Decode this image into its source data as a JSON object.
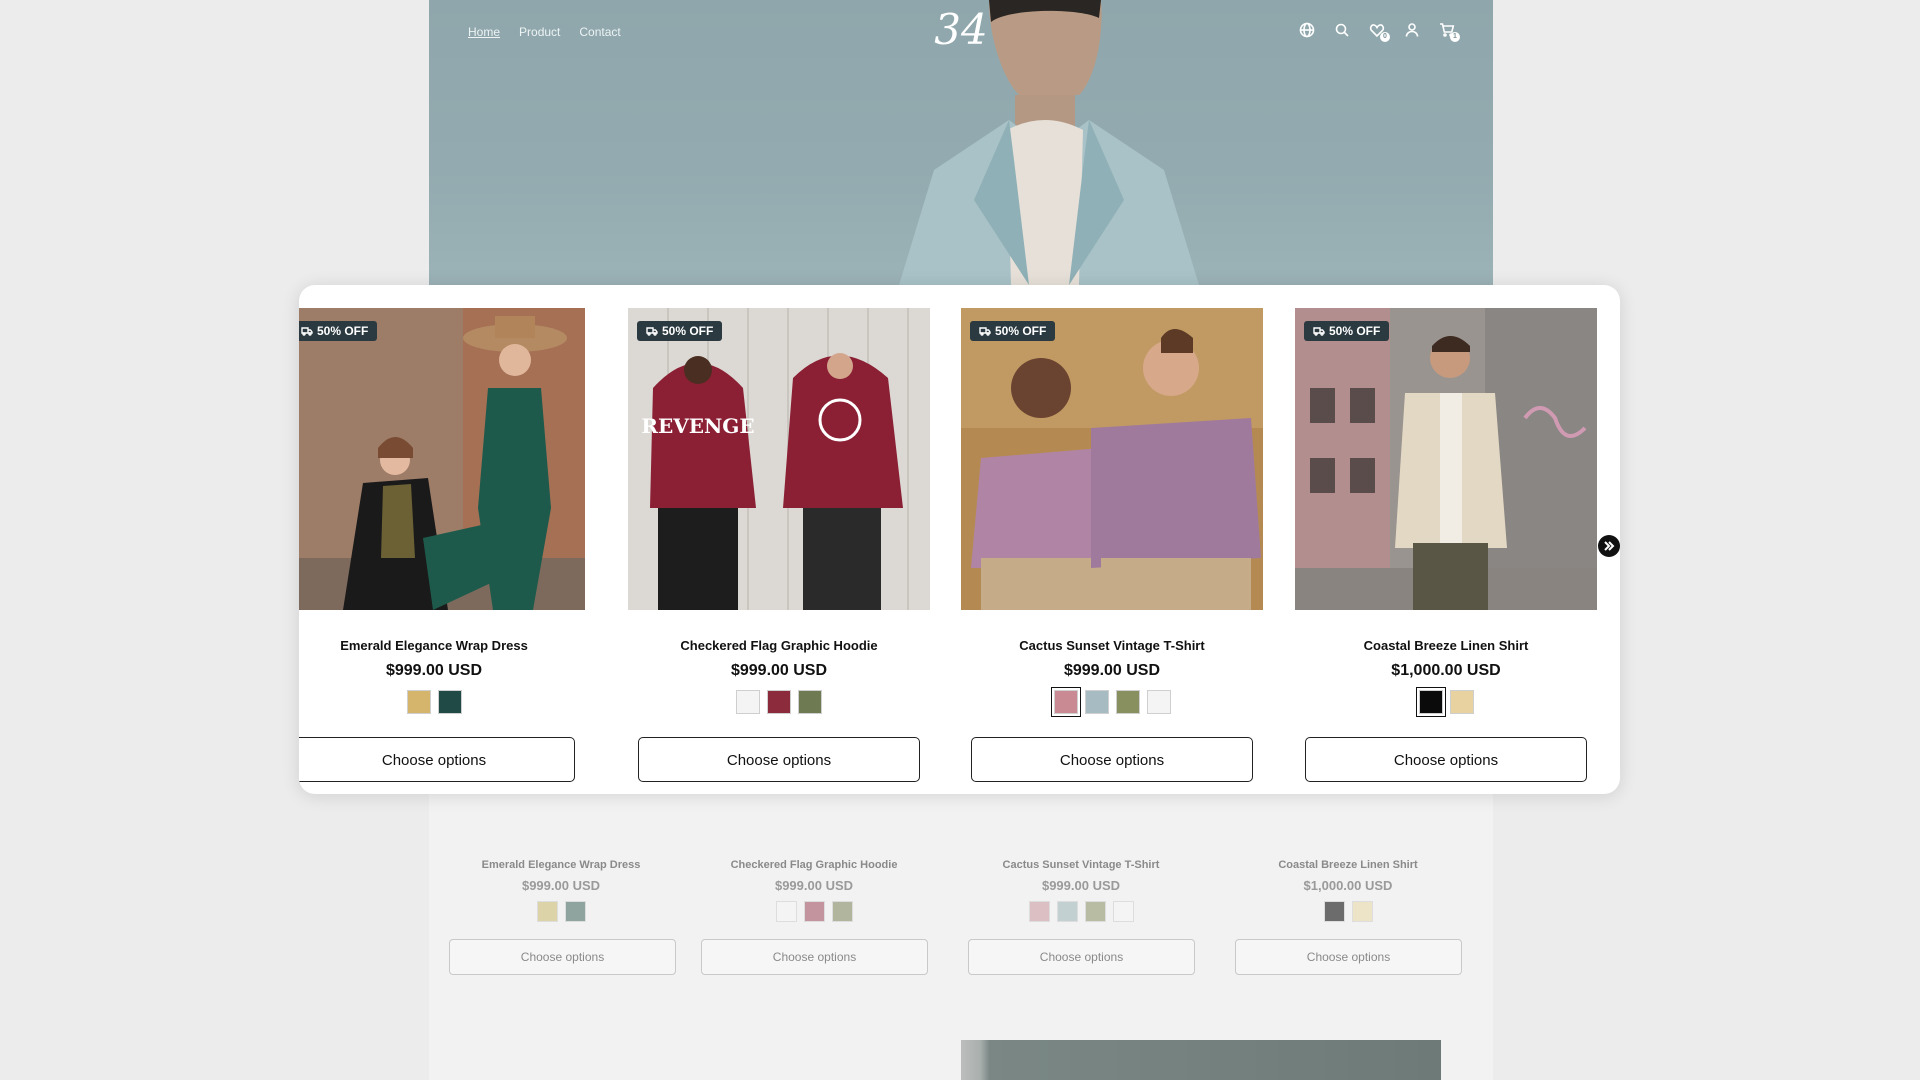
{
  "nav": {
    "items": [
      "Home",
      "Product",
      "Contact"
    ]
  },
  "brand": {
    "logo_text": "34"
  },
  "header_icons": {
    "wishlist_count": "0",
    "cart_count": "1"
  },
  "colors": {
    "badge": "#2b3940",
    "hero": "#93abb0"
  },
  "products": [
    {
      "tag": "50% OFF",
      "title": "Emerald Elegance Wrap Dress",
      "price": "$999.00 USD",
      "swatches": [
        "#d4b56b",
        "#1f4a46"
      ],
      "button": "Choose options"
    },
    {
      "tag": "50% OFF",
      "title": "Checkered Flag Graphic Hoodie",
      "price": "$999.00 USD",
      "swatches": [
        "#f4f4f4",
        "#8b2b3c",
        "#6e7b52"
      ],
      "button": "Choose options"
    },
    {
      "tag": "50% OFF",
      "title": "Cactus Sunset Vintage T-Shirt",
      "price": "$999.00 USD",
      "swatches": [
        "#c98a93",
        "#a6bcc2",
        "#88905f",
        "#f4f4f4"
      ],
      "button": "Choose options"
    },
    {
      "tag": "50% OFF",
      "title": "Coastal Breeze Linen Shirt",
      "price": "$1,000.00 USD",
      "swatches": [
        "#0b0b0b",
        "#e8d2a0"
      ],
      "button": "Choose options"
    }
  ],
  "ghost_products": [
    {
      "title": "Emerald Elegance Wrap Dress",
      "price": "$999.00 USD",
      "swatches": [
        "#dcd3a8",
        "#8fa49f"
      ],
      "button": "Choose options"
    },
    {
      "title": "Checkered Flag Graphic Hoodie",
      "price": "$999.00 USD",
      "swatches": [
        "#f4f4f4",
        "#c4949e",
        "#b1b59d"
      ],
      "button": "Choose options"
    },
    {
      "title": "Cactus Sunset Vintage T-Shirt",
      "price": "$999.00 USD",
      "swatches": [
        "#dbbfc3",
        "#c3d0d1",
        "#b8bca3",
        "#f4f4f4"
      ],
      "button": "Choose options"
    },
    {
      "title": "Coastal Breeze Linen Shirt",
      "price": "$1,000.00 USD",
      "swatches": [
        "#6c6c6c",
        "#ede3c7"
      ],
      "button": "Choose options"
    }
  ]
}
